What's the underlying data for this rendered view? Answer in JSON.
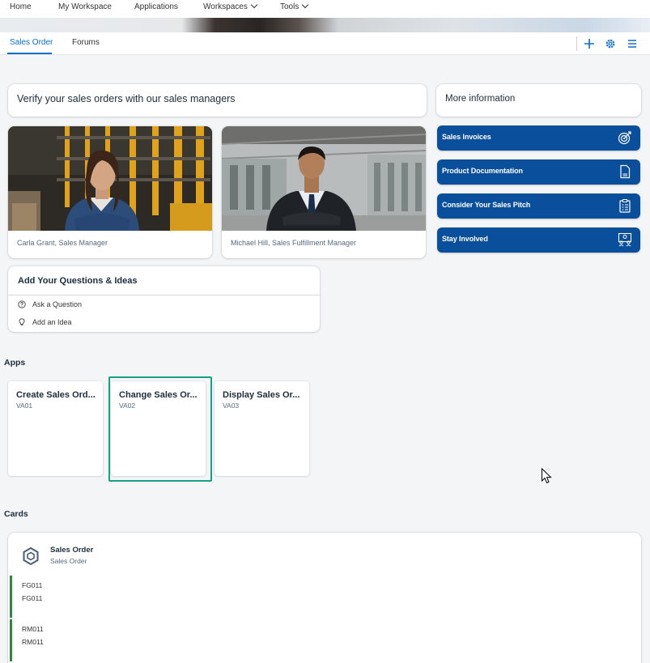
{
  "top_nav": {
    "items": [
      "Home",
      "My Workspace",
      "Applications",
      "Workspaces",
      "Tools"
    ]
  },
  "tabs": {
    "items": [
      "Sales Order",
      "Forums"
    ],
    "active": "Sales Order",
    "icons": [
      "plus-icon",
      "gear-icon",
      "hamburger-menu-icon"
    ]
  },
  "banner": {
    "headline": "Verify your sales orders with our sales managers",
    "more_info": "More information"
  },
  "people": [
    {
      "caption": "Carla Grant, Sales Manager"
    },
    {
      "caption": "Michael Hill, Sales Fulfillment Manager"
    }
  ],
  "links": [
    {
      "label": "Sales Invoices",
      "icon": "target-icon"
    },
    {
      "label": "Product Documentation",
      "icon": "document-icon"
    },
    {
      "label": "Consider Your Sales Pitch",
      "icon": "clipboard-icon"
    },
    {
      "label": "Stay Involved",
      "icon": "community-icon"
    }
  ],
  "questions": {
    "title": "Add Your Questions & Ideas",
    "items": [
      {
        "label": "Ask a Question",
        "icon": "question-icon"
      },
      {
        "label": "Add an Idea",
        "icon": "lightbulb-icon"
      }
    ]
  },
  "apps": {
    "label": "Apps",
    "tiles": [
      {
        "title": "Create Sales Ord...",
        "code": "VA01"
      },
      {
        "title": "Change Sales Or...",
        "code": "VA02"
      },
      {
        "title": "Display Sales Or...",
        "code": "VA03"
      }
    ]
  },
  "cards": {
    "label": "Cards",
    "sales_order": {
      "title": "Sales Order",
      "subtitle": "Sales Order",
      "rows": [
        {
          "line1": "FG011",
          "line2": "FG011"
        },
        {
          "line1": "RM011",
          "line2": "RM011"
        }
      ]
    }
  },
  "colors": {
    "accent": "#0a6ed1",
    "link_button": "#0a4f9c",
    "focus_ring": "#16a085",
    "row_status": "#2b8a3e"
  }
}
